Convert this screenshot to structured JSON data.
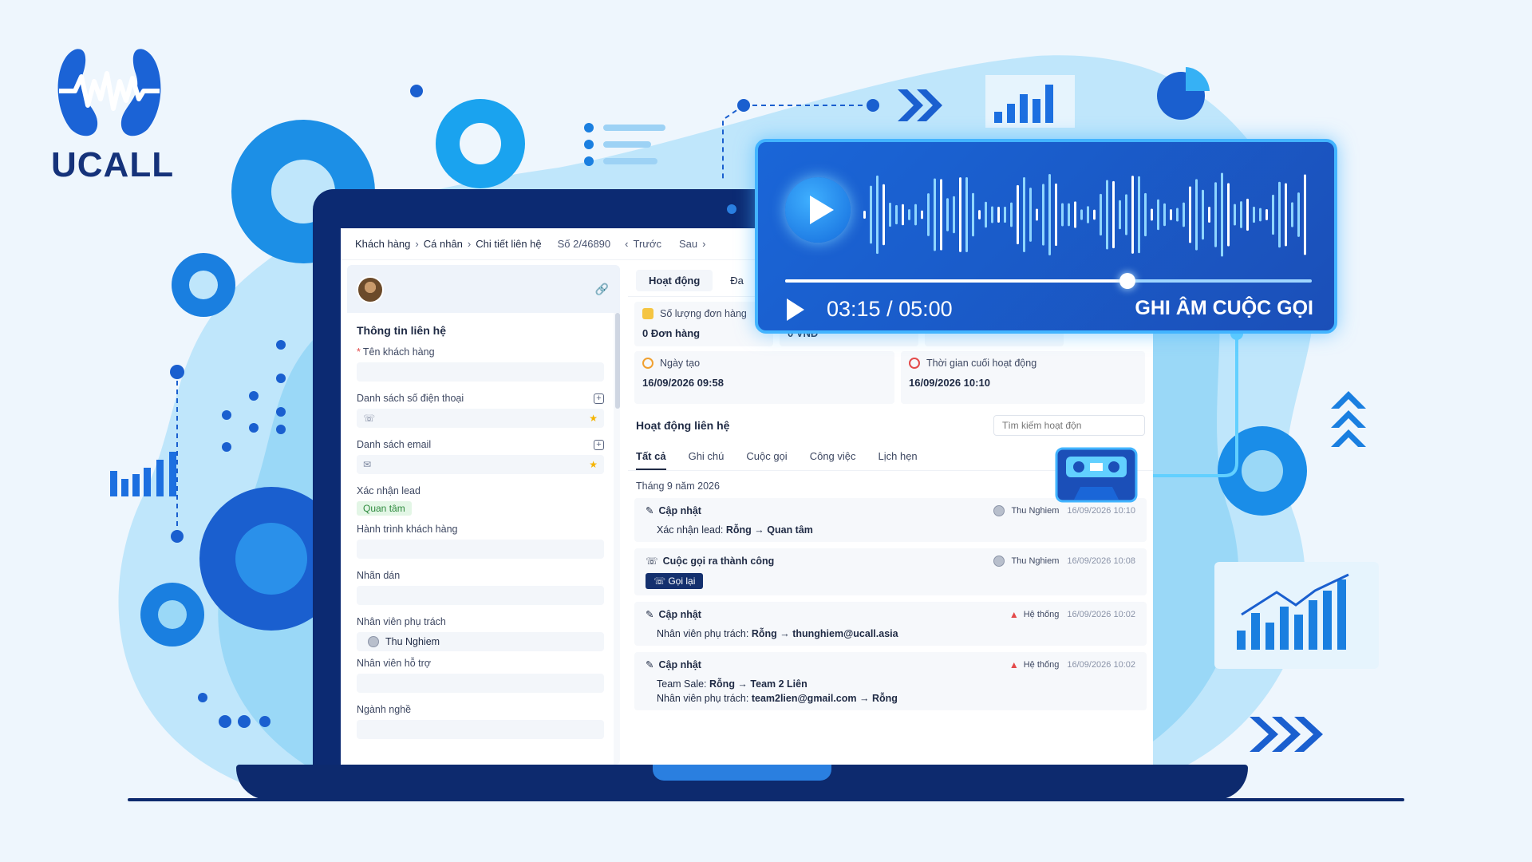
{
  "brand": {
    "name": "UCALL"
  },
  "breadcrumb": {
    "items": [
      "Khách hàng",
      "Cá nhân",
      "Chi tiết liên hệ"
    ],
    "record": "Số 2/46890",
    "prev": "Trước",
    "next": "Sau"
  },
  "contact_panel": {
    "title": "Thông tin liên hệ",
    "fields": {
      "name_label": "Tên khách hàng",
      "phones_label": "Danh sách số điện thoại",
      "emails_label": "Danh sách email",
      "lead_label": "Xác nhận lead",
      "lead_value": "Quan tâm",
      "journey_label": "Hành trình khách hàng",
      "labels_label": "Nhãn dán",
      "owner_label": "Nhân viên phụ trách",
      "owner_value": "Thu Nghiem",
      "support_label": "Nhân viên hỗ trợ",
      "industry_label": "Ngành nghề"
    }
  },
  "detail_tabs": [
    "Hoạt động",
    "Đa"
  ],
  "stats": {
    "orders_label": "Số lượng đơn hàng",
    "orders_value": "0 Đơn hàng",
    "revenue_value": "0 VNĐ",
    "created_label": "Ngày tạo",
    "created_value": "16/09/2026 09:58",
    "last_active_label": "Thời gian cuối hoạt động",
    "last_active_value": "16/09/2026 10:10"
  },
  "activities": {
    "title": "Hoạt động liên hệ",
    "search_placeholder": "Tìm kiếm hoạt độn",
    "tabs": [
      "Tất cả",
      "Ghi chú",
      "Cuộc gọi",
      "Công việc",
      "Lịch hẹn"
    ],
    "month": "Tháng 9 năm 2026",
    "items": [
      {
        "title": "Cập nhật",
        "user": "Thu Nghiem",
        "time": "16/09/2026 10:10",
        "line1_prefix": "Xác nhận lead: ",
        "line1_from": "Rỗng",
        "line1_to": "Quan tâm"
      },
      {
        "title": "Cuộc gọi ra thành công",
        "user": "Thu Nghiem",
        "time": "16/09/2026 10:08",
        "button": "Gọi lại"
      },
      {
        "title": "Cập nhật",
        "user": "Hệ thống",
        "time": "16/09/2026 10:02",
        "line1_prefix": "Nhân viên phụ trách: ",
        "line1_from": "Rỗng",
        "line1_to": "thunghiem@ucall.asia"
      },
      {
        "title": "Cập nhật",
        "user": "Hệ thống",
        "time": "16/09/2026 10:02",
        "line1_prefix": "Team Sale: ",
        "line1_from": "Rỗng",
        "line1_to": "Team 2 Liên",
        "line2_prefix": "Nhân viên phụ trách: ",
        "line2_from": "team2lien@gmail.com",
        "line2_to": "Rỗng"
      }
    ]
  },
  "recording": {
    "time": "03:15 / 05:00",
    "label": "GHI ÂM CUỘC GỌI",
    "progress": 0.65
  },
  "colors": {
    "brand_dark": "#15327a",
    "accent": "#1a66d8",
    "glow": "#42b4ff"
  }
}
